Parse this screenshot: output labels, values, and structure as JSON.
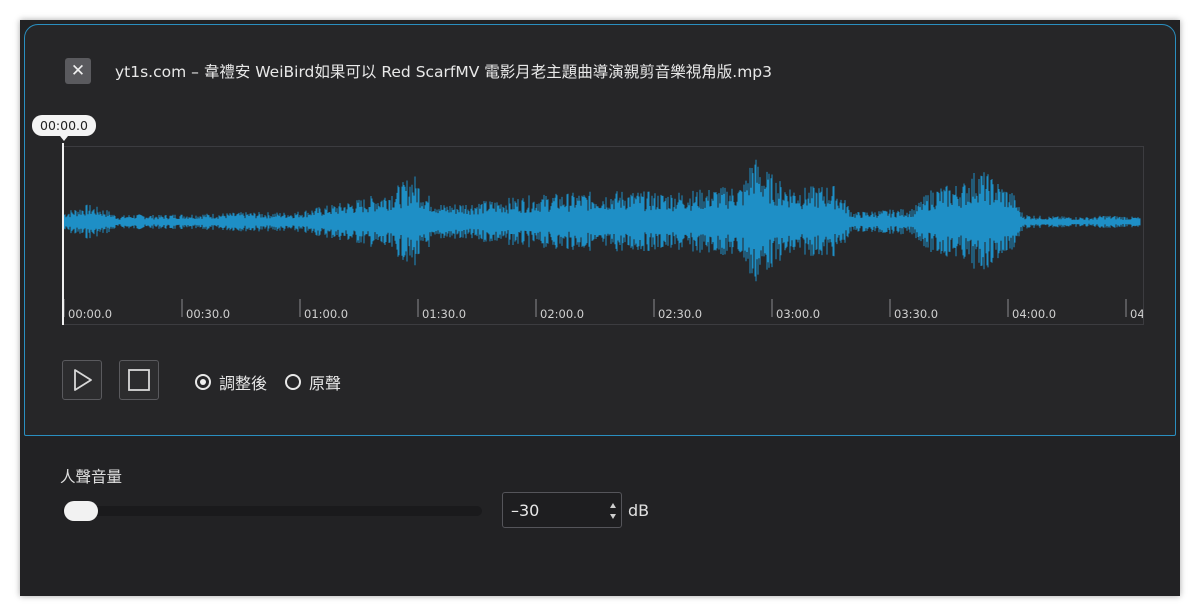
{
  "dialog": {
    "close_label": "✕",
    "file_title": "yt1s.com – 韋禮安 WeiBird如果可以 Red ScarfMV 電影月老主題曲導演親剪音樂視角版.mp3"
  },
  "player": {
    "playhead_time": "00:00.0",
    "timeline_ticks": [
      "00:00.0",
      "00:30.0",
      "01:00.0",
      "01:30.0",
      "02:00.0",
      "02:30.0",
      "03:00.0",
      "03:30.0",
      "04:00.0",
      "04"
    ],
    "waveform_color": "#1e8fc6",
    "play_icon": "play-icon",
    "stop_icon": "stop-icon"
  },
  "mode": {
    "options": [
      {
        "label": "調整後",
        "selected": true
      },
      {
        "label": "原聲",
        "selected": false
      }
    ]
  },
  "vocal_volume": {
    "label": "人聲音量",
    "value": "–30",
    "unit": "dB",
    "slider_level": 0
  },
  "colors": {
    "accent_border": "#2a8fc0",
    "background": "#222224"
  }
}
